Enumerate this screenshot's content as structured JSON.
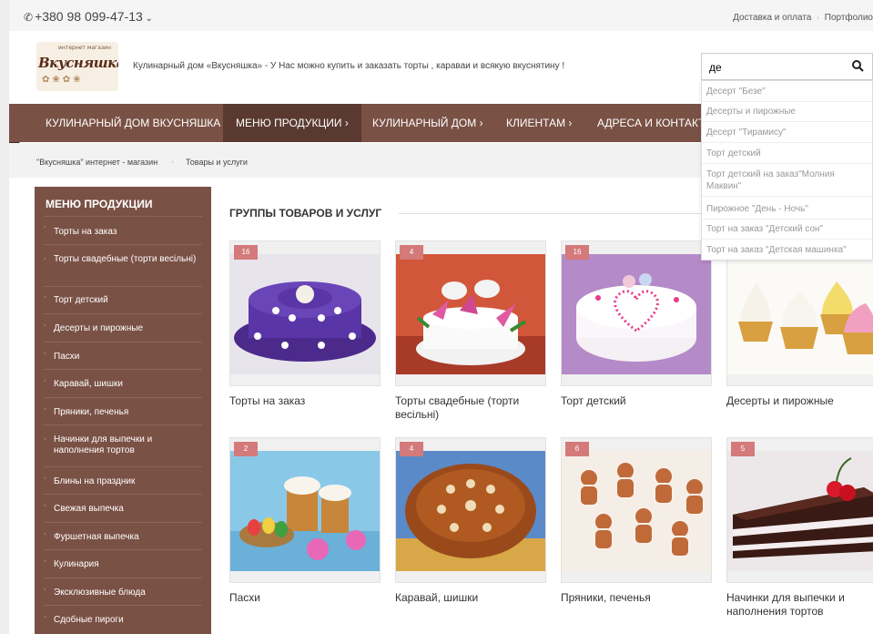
{
  "topbar": {
    "phone": "+380 98 099-47-13",
    "links": [
      "Доставка и оплата",
      "Портфолио"
    ]
  },
  "header": {
    "logo_text": "Вкусняшка",
    "logo_small": "интернет магазин",
    "tagline": "Кулинарный дом «Вкусняшка» - У Нас можно купить и заказать торты , караваи и всякую вкуснятину !"
  },
  "search": {
    "value": "де",
    "suggestions": [
      "Десерт \"Безе\"",
      "Десерты и пирожные",
      "Десерт \"Тирамису\"",
      "Торт детский",
      "Торт детский на заказ\"Молния Маквин\"",
      "Пирожное \"День - Ночь\"",
      "Торт на заказ \"Детский сон\"",
      "Торт на заказ \"Детская машинка\""
    ]
  },
  "nav": {
    "items": [
      "КУЛИНАРНЫЙ ДОМ ВКУСНЯШКА",
      "МЕНЮ ПРОДУКЦИИ  ›",
      "КУЛИНАРНЫЙ ДОМ  ›",
      "КЛИЕНТАМ  ›",
      "АДРЕСА И КОНТАКТЫ"
    ]
  },
  "breadcrumbs": [
    "\"Вкусняшка\" интернет - магазин",
    "Товары и услуги"
  ],
  "sidebar": {
    "title": "МЕНЮ ПРОДУКЦИИ",
    "items": [
      "Торты на заказ",
      "Торты свадебные (торти весільні)",
      "Торт детский",
      "Десерты и пирожные",
      "Пасхи",
      "Каравай, шишки",
      "Пряники, печенья",
      "Начинки для выпечки и наполнения тортов",
      "Блины на праздник",
      "Свежая выпечка",
      "Фуршетная выпечка",
      "Кулинария",
      "Эксклюзивные блюда",
      "Сдобные пироги"
    ]
  },
  "main": {
    "heading": "ГРУППЫ ТОВАРОВ И УСЛУГ",
    "cards": [
      {
        "count": "16",
        "title": "Торты на заказ"
      },
      {
        "count": "4",
        "title": "Торты свадебные (торти весільні)"
      },
      {
        "count": "16",
        "title": "Торт детский"
      },
      {
        "count": "",
        "title": "Десерты и пирожные"
      },
      {
        "count": "2",
        "title": "Пасхи"
      },
      {
        "count": "4",
        "title": "Каравай, шишки"
      },
      {
        "count": "6",
        "title": "Пряники, печенья"
      },
      {
        "count": "5",
        "title": "Начинки для выпечки и наполнения тортов"
      }
    ]
  },
  "colors": {
    "brand_brown": "#7a5145",
    "nav_active": "#5a3a30",
    "badge": "#d47a7a"
  }
}
